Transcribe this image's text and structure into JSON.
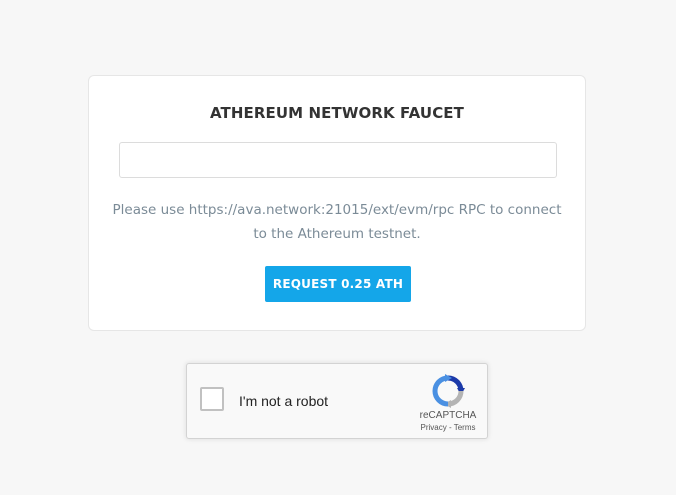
{
  "faucet": {
    "title": "ATHEREUM NETWORK FAUCET",
    "address_input": {
      "value": "",
      "placeholder": ""
    },
    "info_text": "Please use https://ava.network:21015/ext/evm/rpc RPC to connect to the Athereum testnet.",
    "request_button_label": "REQUEST 0.25 ATH"
  },
  "captcha": {
    "checkbox_label": "I'm not a robot",
    "brand": "reCAPTCHA",
    "privacy_link": "Privacy",
    "separator": " - ",
    "terms_link": "Terms",
    "logo_icon": "recaptcha-logo-icon"
  },
  "colors": {
    "accent": "#14a6e9",
    "page_background": "#f7f7f7",
    "info_text": "#7b8b97",
    "title_text": "#333333"
  }
}
